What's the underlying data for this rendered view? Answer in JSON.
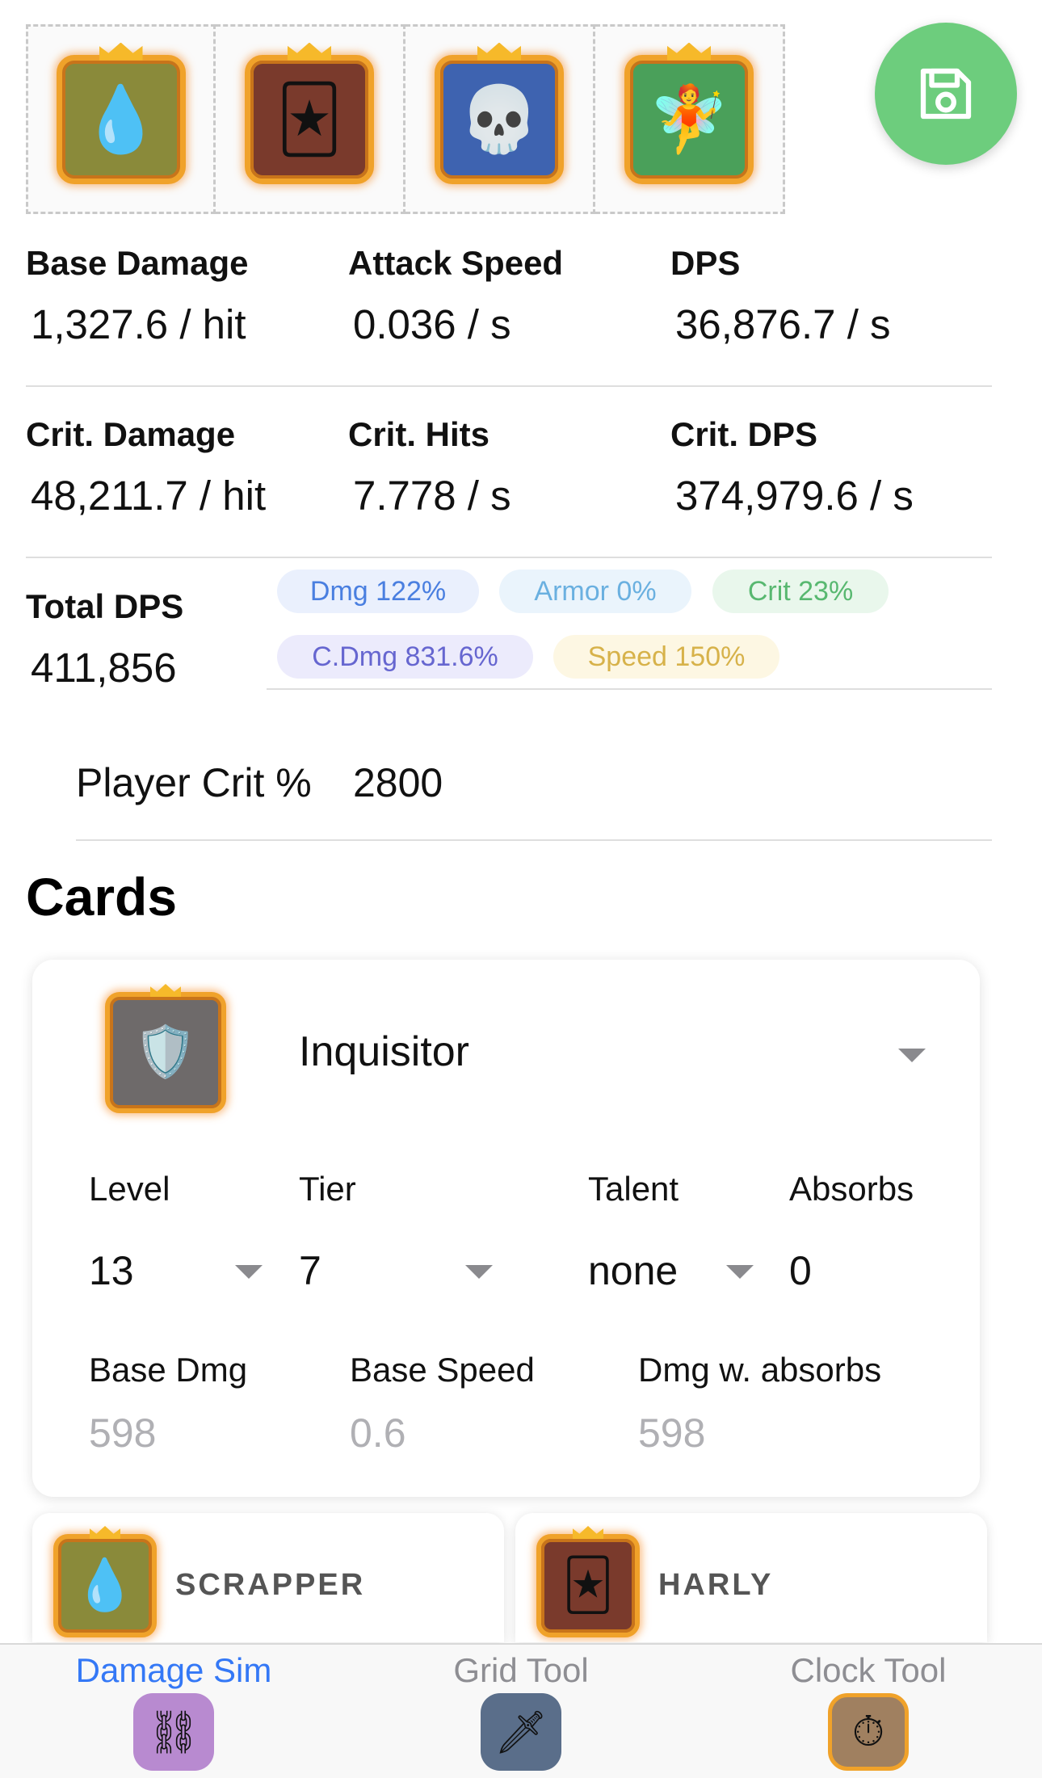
{
  "deck": [
    {
      "name": "scrapper",
      "emoji": "💧",
      "bg": "#8a8a3a"
    },
    {
      "name": "harly",
      "emoji": "🃏",
      "bg": "#7a3a2c"
    },
    {
      "name": "lich",
      "emoji": "💀",
      "bg": "#3e63b0"
    },
    {
      "name": "dryad",
      "emoji": "🧚",
      "bg": "#4aa05a"
    }
  ],
  "stats": {
    "base_damage": {
      "label": "Base Damage",
      "value": "1,327.6 / hit"
    },
    "attack_speed": {
      "label": "Attack Speed",
      "value": "0.036 / s"
    },
    "dps": {
      "label": "DPS",
      "value": "36,876.7 / s"
    },
    "crit_damage": {
      "label": "Crit. Damage",
      "value": "48,211.7 / hit"
    },
    "crit_hits": {
      "label": "Crit. Hits",
      "value": "7.778 / s"
    },
    "crit_dps": {
      "label": "Crit. DPS",
      "value": "374,979.6 / s"
    },
    "total_dps": {
      "label": "Total DPS",
      "value": "411,856"
    }
  },
  "chips": {
    "dmg": "Dmg 122%",
    "armor": "Armor 0%",
    "crit": "Crit 23%",
    "cdmg": "C.Dmg 831.6%",
    "speed": "Speed 150%"
  },
  "player_crit": {
    "label": "Player Crit %",
    "value": "2800"
  },
  "cards_title": "Cards",
  "card": {
    "name": "Inquisitor",
    "emoji": "🛡️",
    "level_label": "Level",
    "level": "13",
    "tier_label": "Tier",
    "tier": "7",
    "talent_label": "Talent",
    "talent": "none",
    "absorbs_label": "Absorbs",
    "absorbs": "0",
    "base_dmg_label": "Base Dmg",
    "base_dmg": "598",
    "base_speed_label": "Base Speed",
    "base_speed": "0.6",
    "dmg_absorbs_label": "Dmg w. absorbs",
    "dmg_absorbs": "598"
  },
  "mini_cards": [
    {
      "name": "SCRAPPER",
      "emoji": "💧",
      "bg": "#8a8a3a"
    },
    {
      "name": "HARLY",
      "emoji": "🃏",
      "bg": "#7a3a2c"
    }
  ],
  "tabs": [
    {
      "label": "Damage Sim",
      "emoji": "⛓",
      "active": true
    },
    {
      "label": "Grid Tool",
      "emoji": "🗡",
      "active": false
    },
    {
      "label": "Clock Tool",
      "emoji": "⏱",
      "active": false
    }
  ],
  "colors": {
    "accent": "#3478f6",
    "fab": "#6dcd7d",
    "card_border": "#f0a22a"
  }
}
